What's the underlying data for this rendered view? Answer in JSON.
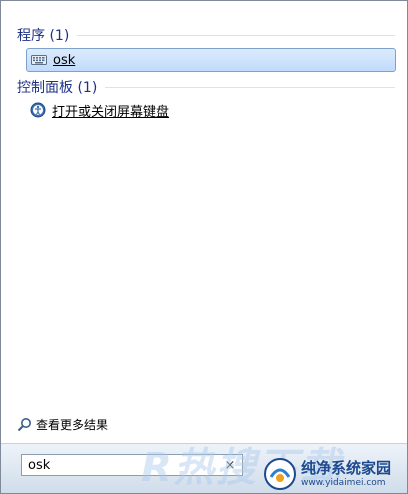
{
  "results": {
    "programs_header": "程序 (1)",
    "program_item": {
      "label": "osk",
      "icon": "keyboard-icon"
    },
    "control_panel_header": "控制面板 (1)",
    "control_panel_item": {
      "label": "打开或关闭屏幕键盘",
      "icon": "ease-of-access-icon"
    }
  },
  "more_results": {
    "label": "查看更多结果",
    "icon": "search-icon"
  },
  "search": {
    "value": "osk",
    "clear_icon": "×"
  },
  "watermark": {
    "text": "R热搜下载"
  },
  "badge": {
    "brand": "纯净系统家园",
    "url": "www.yidaimei.com"
  },
  "colors": {
    "header_text": "#1e3287",
    "selection_bg": "#c1dbfc",
    "selection_border": "#7da2ce",
    "badge_blue": "#1c4a8f"
  }
}
